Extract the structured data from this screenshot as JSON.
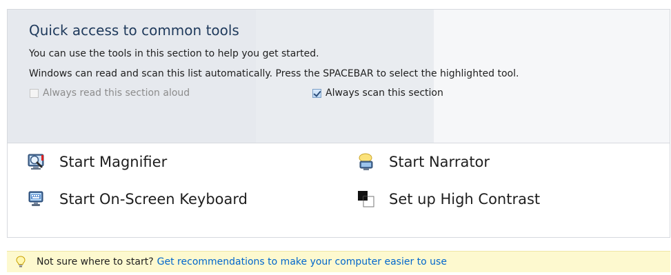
{
  "section": {
    "title": "Quick access to common tools",
    "description_1": "You can use the tools in this section to help you get started.",
    "description_2": "Windows can read and scan this list automatically.  Press the SPACEBAR to select the highlighted tool."
  },
  "options": {
    "read_aloud": {
      "label": "Always read this section aloud",
      "checked": false,
      "enabled": false
    },
    "scan": {
      "label": "Always scan this section",
      "checked": true,
      "enabled": true
    }
  },
  "tools": {
    "magnifier": {
      "label": "Start Magnifier",
      "icon": "magnifier-icon"
    },
    "narrator": {
      "label": "Start Narrator",
      "icon": "narrator-icon"
    },
    "keyboard": {
      "label": "Start On-Screen Keyboard",
      "icon": "keyboard-icon"
    },
    "contrast": {
      "label": "Set up High Contrast",
      "icon": "high-contrast-icon"
    }
  },
  "footer": {
    "question": "Not sure where to start?",
    "link": "Get recommendations to make your computer easier to use",
    "icon": "lightbulb-icon"
  },
  "colors": {
    "title": "#1e395b",
    "link": "#0066cc",
    "footer_bg": "#fdf9cf",
    "scan_bg": "#e6e9ee"
  }
}
